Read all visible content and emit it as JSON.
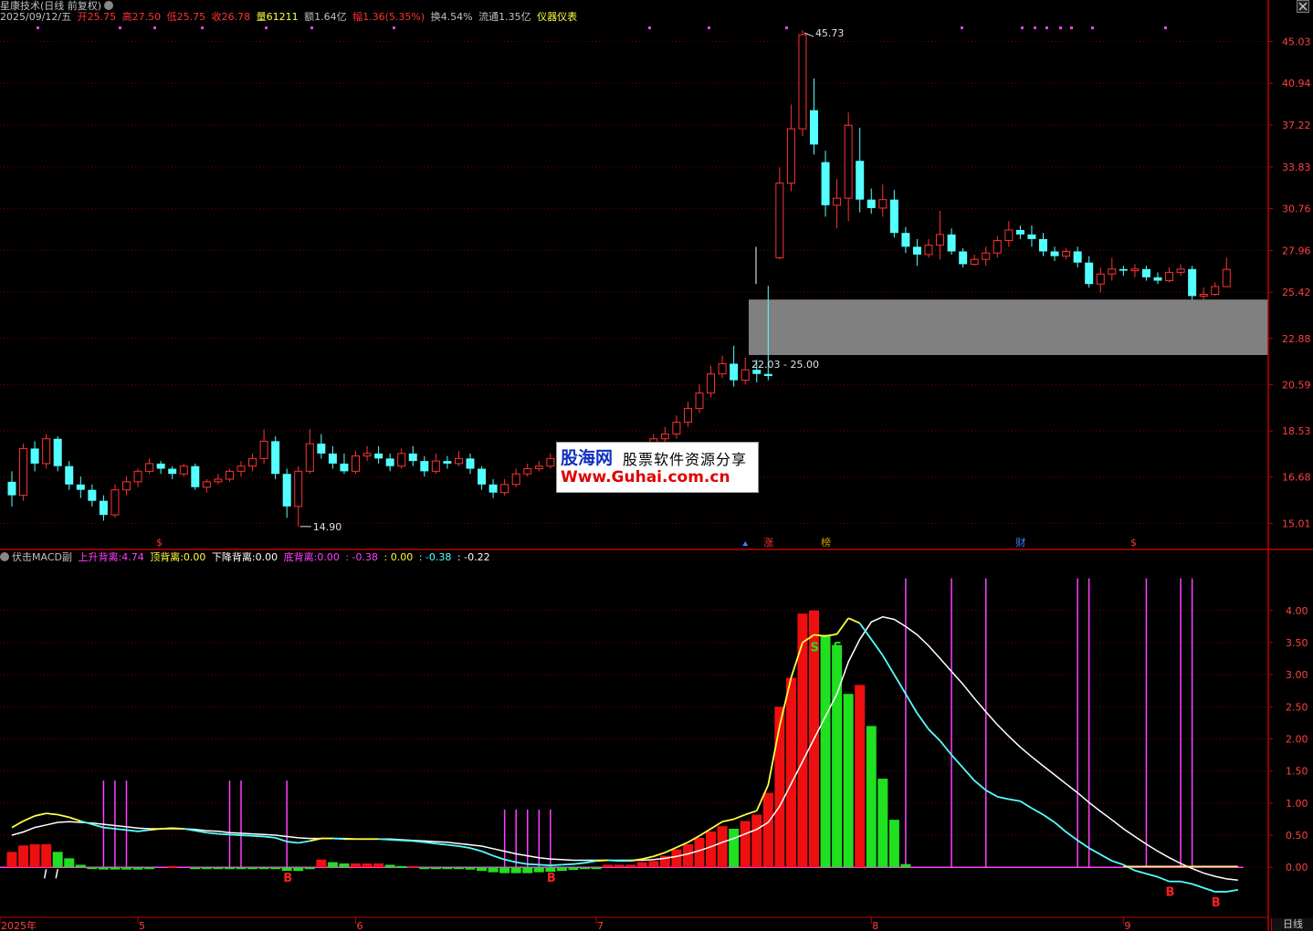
{
  "header": {
    "stock_title": "星康技术(日线 前复权)",
    "date": "2025/09/12/五",
    "open_label": "开",
    "open": "25.75",
    "high_label": "高",
    "high": "27.50",
    "low_label": "低",
    "low": "25.75",
    "close_label": "收",
    "close": "26.78",
    "vol_label": "量",
    "vol": "61211",
    "amt_label": "额",
    "amt": "1.64亿",
    "chg_label": "幅",
    "chg": "1.36(5.35%)",
    "turn_label": "换",
    "turn": "4.54%",
    "float_label": "流通",
    "float": "1.35亿",
    "tool": "仪器仪表"
  },
  "indicator_header": {
    "name": "伏击MACD副",
    "up_div_label": "上升背离:",
    "up_div": "4.74",
    "top_div_label": "顶背离:",
    "top_div": "0.00",
    "down_div_label": "下降背离:",
    "down_div": "0.00",
    "bottom_div_label": "底背离:",
    "bottom_div": "0.00",
    "v1": ": -0.38",
    "v2": ": 0.00",
    "v3": ": -0.38",
    "v4": ": -0.22"
  },
  "colors": {
    "up": "#ff3232",
    "down": "#54ffff",
    "grid": "#7a0000",
    "axis": "#c00000",
    "magenta": "#ff40ff",
    "yellow": "#ffff40"
  },
  "price_axis": [
    "45.03",
    "40.94",
    "37.22",
    "33.83",
    "30.76",
    "27.96",
    "25.42",
    "22.88",
    "20.59",
    "18.53",
    "16.68",
    "15.01"
  ],
  "macd_axis": [
    "4.00",
    "3.50",
    "3.00",
    "2.50",
    "2.00",
    "1.50",
    "1.00",
    "0.50",
    "0.00"
  ],
  "time_axis": [
    {
      "label": "2025年",
      "idx": 0
    },
    {
      "label": "5",
      "idx": 11
    },
    {
      "label": "6",
      "idx": 30
    },
    {
      "label": "7",
      "idx": 51
    },
    {
      "label": "8",
      "idx": 75
    },
    {
      "label": "9",
      "idx": 97
    }
  ],
  "annotations": {
    "high_mark": "45.73",
    "low_mark": "14.90",
    "zone": "22.03 - 25.00",
    "period": "日线"
  },
  "events": [
    {
      "label": "$",
      "idx": 13,
      "color": "#ff3232"
    },
    {
      "label": "涨",
      "idx": 66,
      "color": "#ff3232"
    },
    {
      "label": "榜",
      "idx": 71,
      "color": "#d0a000"
    },
    {
      "label": "财",
      "idx": 88,
      "color": "#4080ff"
    },
    {
      "label": "$",
      "idx": 98,
      "color": "#ff3232"
    }
  ],
  "signals": [
    {
      "label": "B",
      "idx": 24,
      "pos": "low"
    },
    {
      "label": "B",
      "idx": 47,
      "pos": "low"
    },
    {
      "label": "S",
      "idx": 70,
      "pos": "high"
    },
    {
      "label": "S",
      "idx": 72,
      "pos": "high"
    },
    {
      "label": "B",
      "idx": 101,
      "pos": "low"
    },
    {
      "label": "B",
      "idx": 105,
      "pos": "low"
    }
  ],
  "watermark": {
    "title": "股海网",
    "subtitle": "股票软件资源分享",
    "url": "Www.Guhai.com.cn"
  },
  "chart_data": {
    "type": "candlestick",
    "price_range": [
      14.2,
      46.5
    ],
    "zone": [
      22.03,
      25.0
    ],
    "candles": [
      [
        16.5,
        16.0,
        16.9,
        15.6
      ],
      [
        16.0,
        17.8,
        18.0,
        15.8
      ],
      [
        17.8,
        17.2,
        18.1,
        16.9
      ],
      [
        17.2,
        18.2,
        18.4,
        17.0
      ],
      [
        18.2,
        17.1,
        18.3,
        16.9
      ],
      [
        17.1,
        16.4,
        17.3,
        16.2
      ],
      [
        16.4,
        16.2,
        16.7,
        15.9
      ],
      [
        16.2,
        15.8,
        16.4,
        15.6
      ],
      [
        15.8,
        15.3,
        16.0,
        15.1
      ],
      [
        15.3,
        16.2,
        16.4,
        15.2
      ],
      [
        16.2,
        16.5,
        16.7,
        16.0
      ],
      [
        16.5,
        16.9,
        17.0,
        16.3
      ],
      [
        16.9,
        17.2,
        17.4,
        16.8
      ],
      [
        17.2,
        17.0,
        17.3,
        16.8
      ],
      [
        17.0,
        16.8,
        17.1,
        16.6
      ],
      [
        16.8,
        17.1,
        17.2,
        16.7
      ],
      [
        17.1,
        16.3,
        17.2,
        16.2
      ],
      [
        16.3,
        16.5,
        16.6,
        16.1
      ],
      [
        16.5,
        16.6,
        16.8,
        16.4
      ],
      [
        16.6,
        16.9,
        17.0,
        16.5
      ],
      [
        16.9,
        17.1,
        17.3,
        16.7
      ],
      [
        17.1,
        17.4,
        17.6,
        16.9
      ],
      [
        17.4,
        18.1,
        18.6,
        17.2
      ],
      [
        18.1,
        16.8,
        18.3,
        16.6
      ],
      [
        16.8,
        15.6,
        17.0,
        15.2
      ],
      [
        15.6,
        16.9,
        17.1,
        14.9
      ],
      [
        16.9,
        18.0,
        18.6,
        16.8
      ],
      [
        18.0,
        17.6,
        18.4,
        17.4
      ],
      [
        17.6,
        17.2,
        17.9,
        17.0
      ],
      [
        17.2,
        16.9,
        17.6,
        16.8
      ],
      [
        16.9,
        17.5,
        17.7,
        16.8
      ],
      [
        17.5,
        17.6,
        17.9,
        17.3
      ],
      [
        17.6,
        17.4,
        17.9,
        17.2
      ],
      [
        17.4,
        17.1,
        17.6,
        16.9
      ],
      [
        17.1,
        17.6,
        17.8,
        17.0
      ],
      [
        17.6,
        17.3,
        17.9,
        17.1
      ],
      [
        17.3,
        16.9,
        17.5,
        16.7
      ],
      [
        16.9,
        17.3,
        17.6,
        16.8
      ],
      [
        17.3,
        17.2,
        17.5,
        17.0
      ],
      [
        17.2,
        17.4,
        17.7,
        17.1
      ],
      [
        17.4,
        17.0,
        17.6,
        16.8
      ],
      [
        17.0,
        16.4,
        17.1,
        16.2
      ],
      [
        16.4,
        16.1,
        16.6,
        15.9
      ],
      [
        16.1,
        16.4,
        16.6,
        16.0
      ],
      [
        16.4,
        16.8,
        17.0,
        16.3
      ],
      [
        16.8,
        17.0,
        17.2,
        16.7
      ],
      [
        17.0,
        17.1,
        17.3,
        16.9
      ],
      [
        17.1,
        17.4,
        17.6,
        17.0
      ],
      [
        17.4,
        17.5,
        17.7,
        17.2
      ],
      [
        17.5,
        17.3,
        17.7,
        17.2
      ],
      [
        17.3,
        17.4,
        17.6,
        17.2
      ],
      [
        17.4,
        17.6,
        17.8,
        17.3
      ],
      [
        17.6,
        17.3,
        17.8,
        17.1
      ],
      [
        17.3,
        17.0,
        17.5,
        16.8
      ],
      [
        17.0,
        17.4,
        17.6,
        16.9
      ],
      [
        17.4,
        17.8,
        18.0,
        17.3
      ],
      [
        17.8,
        18.2,
        18.4,
        17.6
      ],
      [
        18.2,
        18.4,
        18.7,
        18.0
      ],
      [
        18.4,
        18.9,
        19.2,
        18.2
      ],
      [
        18.9,
        19.5,
        19.8,
        18.7
      ],
      [
        19.5,
        20.2,
        20.6,
        19.3
      ],
      [
        20.2,
        21.1,
        21.5,
        20.0
      ],
      [
        21.1,
        21.6,
        22.0,
        20.9
      ],
      [
        21.6,
        20.8,
        22.5,
        20.5
      ],
      [
        20.8,
        21.3,
        21.9,
        20.6
      ],
      [
        21.3,
        21.1,
        21.8,
        20.7
      ],
      [
        21.1,
        21.0,
        25.8,
        20.8
      ],
      [
        27.5,
        32.6,
        33.8,
        27.4
      ],
      [
        32.6,
        36.9,
        39.0,
        32.0
      ],
      [
        36.9,
        45.73,
        46.2,
        36.3
      ],
      [
        38.5,
        35.6,
        41.4,
        34.8
      ],
      [
        34.2,
        31.0,
        35.1,
        30.2
      ],
      [
        31.0,
        31.5,
        32.9,
        29.4
      ],
      [
        31.5,
        37.2,
        38.3,
        29.9
      ],
      [
        34.3,
        31.4,
        37.0,
        30.5
      ],
      [
        31.4,
        30.8,
        32.2,
        30.4
      ],
      [
        30.8,
        31.4,
        32.5,
        30.2
      ],
      [
        31.4,
        29.1,
        32.1,
        28.8
      ],
      [
        29.1,
        28.2,
        29.5,
        27.8
      ],
      [
        28.2,
        27.7,
        28.7,
        27.0
      ],
      [
        27.7,
        28.3,
        28.7,
        27.5
      ],
      [
        28.3,
        29.0,
        30.6,
        27.4
      ],
      [
        29.0,
        27.9,
        29.4,
        27.7
      ],
      [
        27.9,
        27.1,
        28.1,
        26.9
      ],
      [
        27.1,
        27.4,
        27.7,
        27.0
      ],
      [
        27.4,
        27.8,
        28.2,
        27.0
      ],
      [
        27.8,
        28.6,
        28.9,
        27.5
      ],
      [
        28.6,
        29.3,
        29.9,
        28.2
      ],
      [
        29.3,
        29.0,
        29.6,
        28.7
      ],
      [
        29.0,
        28.7,
        29.6,
        28.2
      ],
      [
        28.7,
        27.9,
        29.1,
        27.6
      ],
      [
        27.9,
        27.6,
        28.2,
        27.3
      ],
      [
        27.6,
        27.9,
        28.1,
        27.4
      ],
      [
        27.9,
        27.2,
        28.2,
        26.9
      ],
      [
        27.2,
        25.9,
        27.6,
        25.7
      ],
      [
        25.9,
        26.5,
        26.9,
        25.4
      ],
      [
        26.5,
        26.8,
        27.5,
        26.1
      ],
      [
        26.8,
        26.7,
        27.0,
        26.4
      ],
      [
        26.7,
        26.8,
        27.1,
        26.3
      ],
      [
        26.8,
        26.3,
        27.0,
        26.1
      ],
      [
        26.3,
        26.1,
        26.6,
        25.9
      ],
      [
        26.1,
        26.6,
        26.9,
        26.0
      ],
      [
        26.6,
        26.8,
        27.1,
        26.4
      ],
      [
        26.8,
        25.2,
        27.0,
        25.0
      ],
      [
        25.2,
        25.3,
        25.7,
        25.0
      ],
      [
        25.3,
        25.75,
        26.0,
        25.2
      ],
      [
        25.75,
        26.78,
        27.5,
        25.75
      ]
    ],
    "macd": {
      "range": [
        -0.75,
        4.75
      ],
      "dif": [
        0.62,
        0.72,
        0.8,
        0.84,
        0.82,
        0.78,
        0.72,
        0.67,
        0.62,
        0.6,
        0.58,
        0.56,
        0.58,
        0.6,
        0.61,
        0.6,
        0.57,
        0.54,
        0.52,
        0.51,
        0.5,
        0.49,
        0.48,
        0.46,
        0.4,
        0.38,
        0.41,
        0.45,
        0.45,
        0.44,
        0.44,
        0.44,
        0.44,
        0.43,
        0.42,
        0.41,
        0.39,
        0.37,
        0.35,
        0.33,
        0.3,
        0.25,
        0.18,
        0.12,
        0.08,
        0.05,
        0.04,
        0.03,
        0.04,
        0.05,
        0.07,
        0.1,
        0.11,
        0.1,
        0.1,
        0.13,
        0.17,
        0.23,
        0.31,
        0.39,
        0.49,
        0.6,
        0.71,
        0.75,
        0.82,
        0.88,
        1.28,
        2.2,
        2.95,
        3.5,
        3.62,
        3.6,
        3.63,
        3.88,
        3.8,
        3.55,
        3.3,
        3.0,
        2.7,
        2.4,
        2.15,
        1.97,
        1.75,
        1.55,
        1.35,
        1.2,
        1.1,
        1.06,
        1.03,
        0.92,
        0.82,
        0.7,
        0.55,
        0.42,
        0.3,
        0.2,
        0.1,
        0.04,
        -0.05,
        -0.1,
        -0.15,
        -0.22,
        -0.22,
        -0.26,
        -0.32,
        -0.38,
        -0.38,
        -0.35
      ],
      "dea": [
        0.5,
        0.55,
        0.62,
        0.66,
        0.7,
        0.71,
        0.7,
        0.69,
        0.67,
        0.65,
        0.63,
        0.61,
        0.6,
        0.6,
        0.6,
        0.6,
        0.59,
        0.57,
        0.56,
        0.54,
        0.53,
        0.52,
        0.51,
        0.5,
        0.48,
        0.46,
        0.45,
        0.45,
        0.45,
        0.45,
        0.44,
        0.44,
        0.44,
        0.44,
        0.43,
        0.42,
        0.41,
        0.4,
        0.39,
        0.37,
        0.35,
        0.33,
        0.29,
        0.25,
        0.21,
        0.18,
        0.15,
        0.13,
        0.12,
        0.11,
        0.11,
        0.11,
        0.11,
        0.11,
        0.11,
        0.11,
        0.12,
        0.14,
        0.17,
        0.21,
        0.26,
        0.32,
        0.39,
        0.45,
        0.52,
        0.59,
        0.7,
        0.95,
        1.3,
        1.65,
        2.0,
        2.35,
        2.7,
        3.2,
        3.55,
        3.82,
        3.9,
        3.86,
        3.75,
        3.62,
        3.45,
        3.25,
        3.05,
        2.85,
        2.63,
        2.42,
        2.22,
        2.04,
        1.87,
        1.72,
        1.58,
        1.44,
        1.3,
        1.16,
        1.01,
        0.87,
        0.74,
        0.6,
        0.48,
        0.36,
        0.25,
        0.15,
        0.06,
        -0.02,
        -0.09,
        -0.14,
        -0.18,
        -0.2
      ],
      "hist": [
        0.24,
        0.34,
        0.36,
        0.36,
        0.24,
        0.14,
        0.04,
        -0.04,
        -0.1,
        -0.1,
        -0.1,
        -0.1,
        -0.04,
        0.0,
        0.02,
        0.0,
        -0.04,
        -0.06,
        -0.08,
        -0.06,
        -0.06,
        -0.06,
        -0.06,
        -0.08,
        -0.16,
        -0.16,
        -0.08,
        0.12,
        0.08,
        0.06,
        0.06,
        0.06,
        0.06,
        0.04,
        0.02,
        0.02,
        -0.04,
        -0.06,
        -0.08,
        -0.08,
        -0.1,
        -0.16,
        -0.22,
        -0.26,
        -0.26,
        -0.26,
        -0.22,
        -0.2,
        -0.16,
        -0.12,
        -0.08,
        -0.02,
        0.04,
        0.04,
        0.04,
        0.08,
        0.1,
        0.18,
        0.28,
        0.36,
        0.46,
        0.56,
        0.64,
        0.6,
        0.72,
        0.82,
        1.16,
        2.5,
        2.95,
        3.95,
        4.0,
        3.62,
        3.46,
        2.7,
        2.84,
        2.2,
        1.38,
        0.74,
        0.05,
        0,
        0,
        0,
        0,
        0,
        0,
        0,
        0,
        0,
        0,
        0,
        0,
        0,
        0,
        0,
        0,
        0,
        0,
        0,
        0,
        0,
        0,
        0,
        0,
        0,
        0,
        0,
        0,
        0
      ]
    },
    "magenta_lines_main": [
      8,
      9,
      10,
      19,
      20,
      24
    ],
    "magenta_lines_mid": [
      43,
      44,
      45,
      46,
      47
    ],
    "magenta_lines_tall": [
      78,
      82,
      85,
      93,
      94,
      99,
      102,
      103
    ]
  }
}
